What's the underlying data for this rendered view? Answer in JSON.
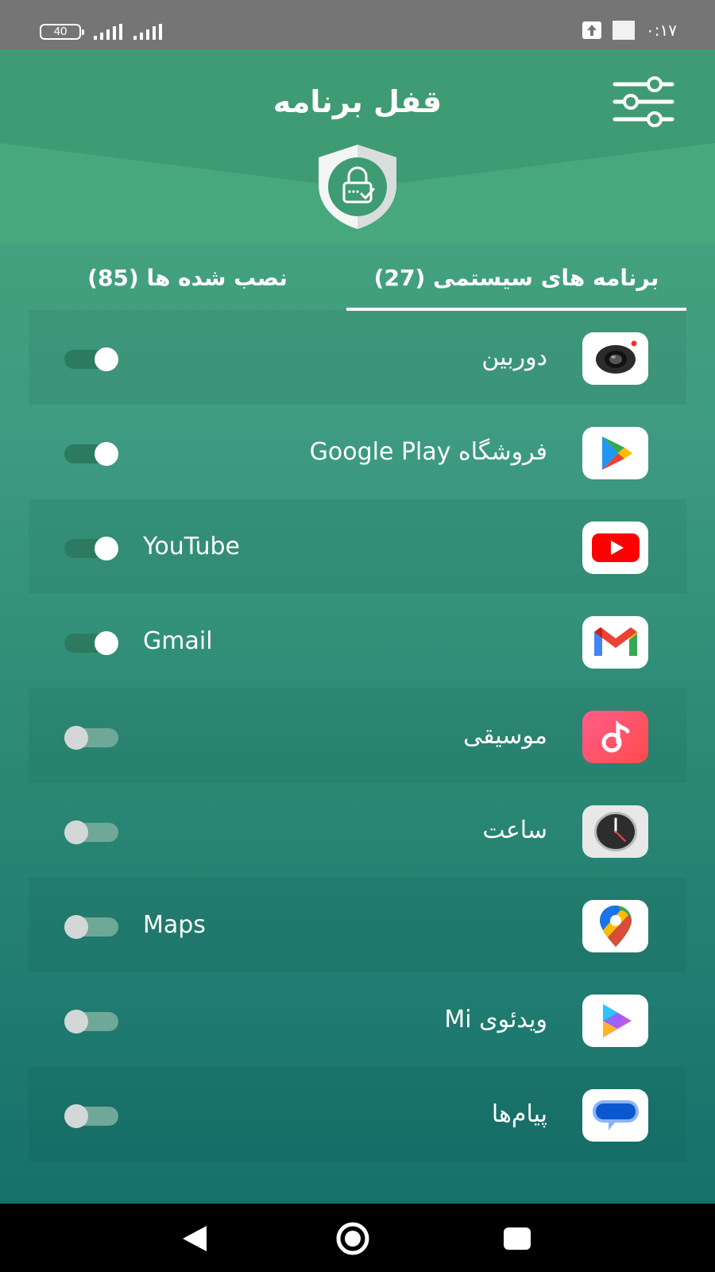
{
  "status_bar": {
    "battery": "40",
    "time": "۰:۱۷"
  },
  "header": {
    "title": "قفل برنامه",
    "filter_icon": "sliders-icon",
    "shield_icon": "shield-lock-icon"
  },
  "tabs": [
    {
      "label": "برنامه های سیستمی (27)",
      "selected": true
    },
    {
      "label": "نصب شده ها (85)",
      "selected": false
    }
  ],
  "apps": [
    {
      "name": "دوربین",
      "icon": "camera-icon",
      "locked": true
    },
    {
      "name": "فروشگاه Google Play",
      "icon": "google-play-icon",
      "locked": true
    },
    {
      "name": "YouTube",
      "icon": "youtube-icon",
      "locked": true
    },
    {
      "name": "Gmail",
      "icon": "gmail-icon",
      "locked": true
    },
    {
      "name": "موسیقی",
      "icon": "music-icon",
      "locked": false
    },
    {
      "name": "ساعت",
      "icon": "clock-icon",
      "locked": false
    },
    {
      "name": "Maps",
      "icon": "maps-icon",
      "locked": false
    },
    {
      "name": "ویدئوی Mi",
      "icon": "mi-video-icon",
      "locked": false
    },
    {
      "name": "پیام‌ها",
      "icon": "messages-icon",
      "locked": false
    }
  ],
  "colors": {
    "accent_green": "#3d9a80",
    "toggle_on_track": "#2c7a5f",
    "toggle_off_track": "#6fa898"
  }
}
